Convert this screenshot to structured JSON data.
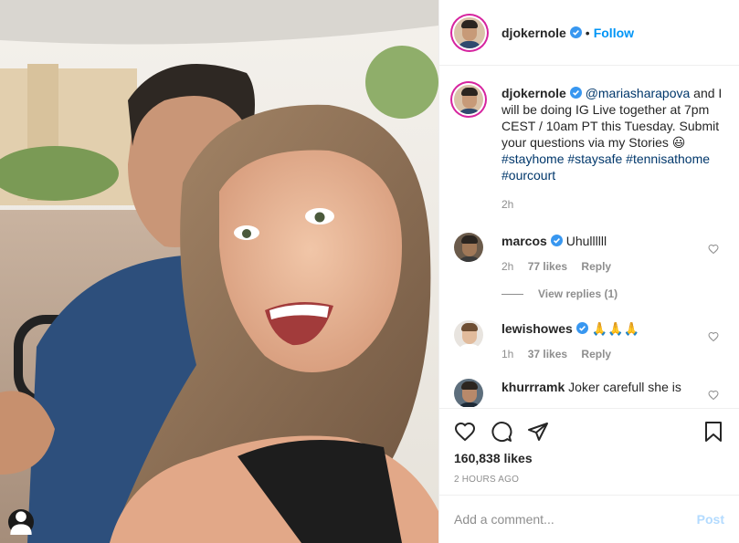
{
  "post": {
    "username": "djokernole",
    "follow_label": "Follow",
    "dot": "•",
    "caption": {
      "mention": "@mariasharapova",
      "text": " and I will be doing IG Live together at 7pm CEST / 10am PT this Tuesday. Submit your questions via my Stories 😃",
      "hashtags": "#stayhome #staysafe #tennisathome #ourcourt",
      "time": "2h"
    },
    "likes": "160,838 likes",
    "posted_ago": "2 HOURS AGO"
  },
  "comments": [
    {
      "username": "marcos",
      "verified": true,
      "text": "Uhullllll",
      "time": "2h",
      "likes": "77 likes",
      "reply": "Reply",
      "view_replies": "View replies (1)"
    },
    {
      "username": "lewishowes",
      "verified": true,
      "text": "🙏🙏🙏",
      "time": "1h",
      "likes": "37 likes",
      "reply": "Reply"
    },
    {
      "username": "khurrramk",
      "verified": false,
      "text": "Joker carefull she is"
    }
  ],
  "composer": {
    "placeholder": "Add a comment...",
    "post_label": "Post"
  },
  "icons": [
    "heart-icon",
    "comment-icon",
    "share-icon",
    "bookmark-icon",
    "verified-badge-icon",
    "user-tag-icon"
  ],
  "colors": {
    "accent": "#0095f6",
    "verified": "#3897f0",
    "post_disabled": "#b3dbff",
    "meta": "#8e8e8e"
  }
}
